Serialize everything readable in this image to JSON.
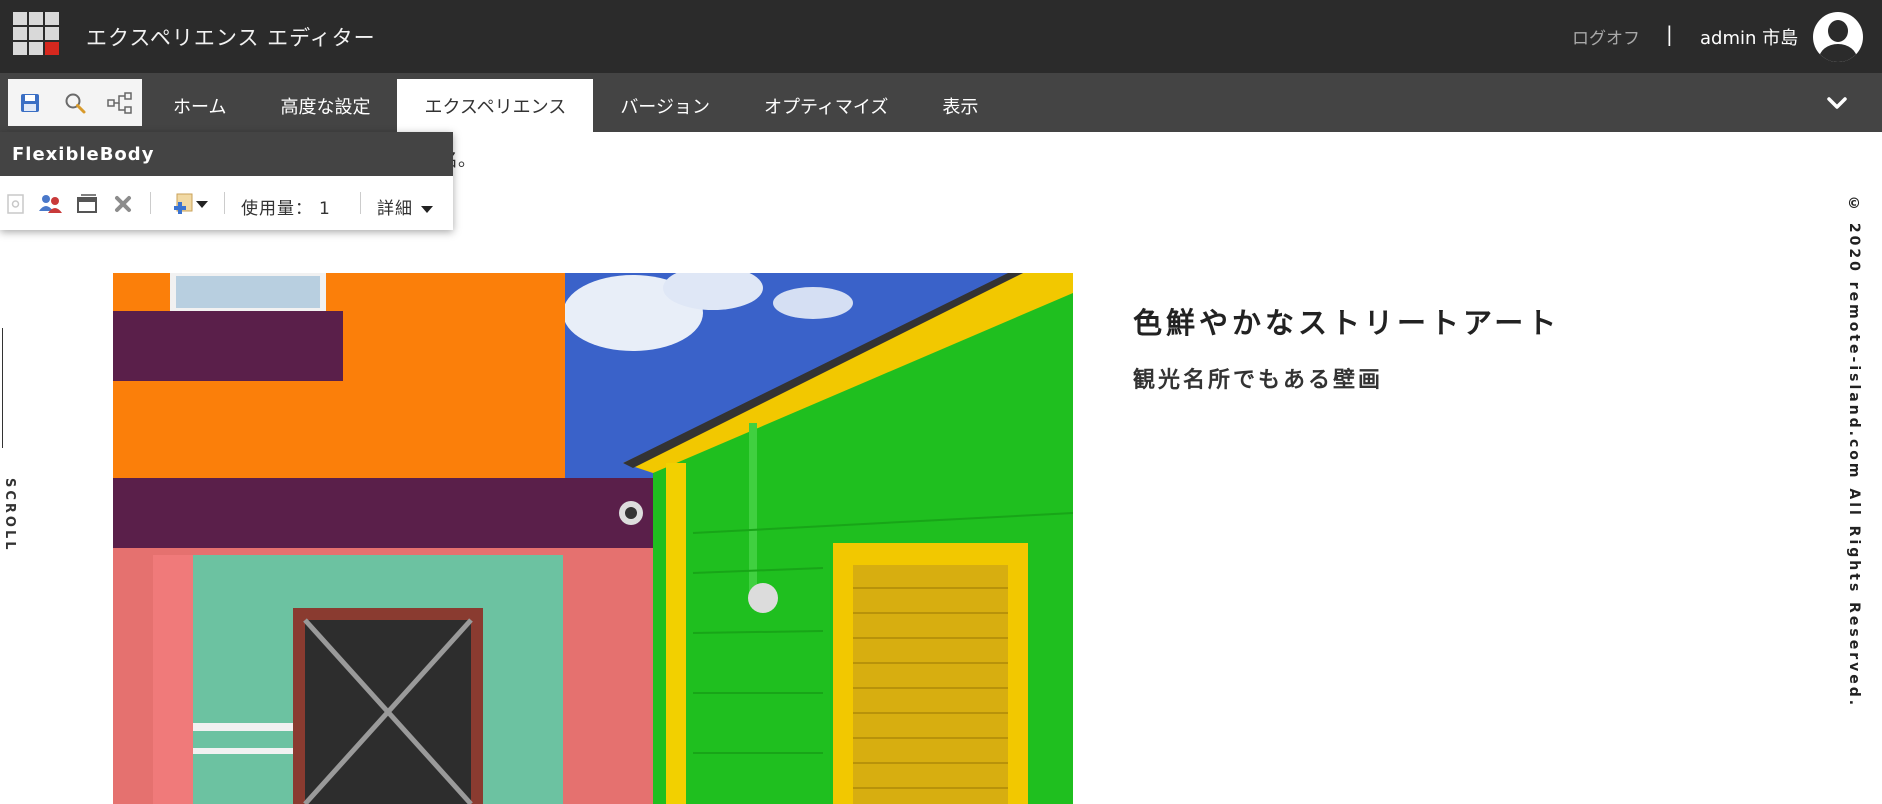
{
  "app": {
    "title": "エクスペリエンス エディター",
    "logoff_label": "ログオフ",
    "separator": "|",
    "user_name": "admin 市島"
  },
  "ribbon": {
    "tabs": [
      {
        "label": "ホーム",
        "active": false
      },
      {
        "label": "高度な設定",
        "active": false
      },
      {
        "label": "エクスペリエンス",
        "active": true
      },
      {
        "label": "バージョン",
        "active": false
      },
      {
        "label": "オプティマイズ",
        "active": false
      },
      {
        "label": "表示",
        "active": false
      }
    ],
    "quick_tools": [
      "save-icon",
      "search-icon",
      "navigation-tree-icon"
    ]
  },
  "component_toolbar": {
    "title": "FlexibleBody",
    "usage_label": "使用量：",
    "usage_value": "1",
    "details_label": "詳細"
  },
  "page": {
    "partial_text": "名。",
    "scroll_label": "SCROLL",
    "heading": "色鮮やかなストリートアート",
    "subheading": "観光名所でもある壁画",
    "copyright": "© 2020 remote-island.com All Rights Reserved."
  },
  "colors": {
    "topbar": "#2b2b2b",
    "ribbon": "#444444",
    "accent_red": "#d6281e"
  }
}
